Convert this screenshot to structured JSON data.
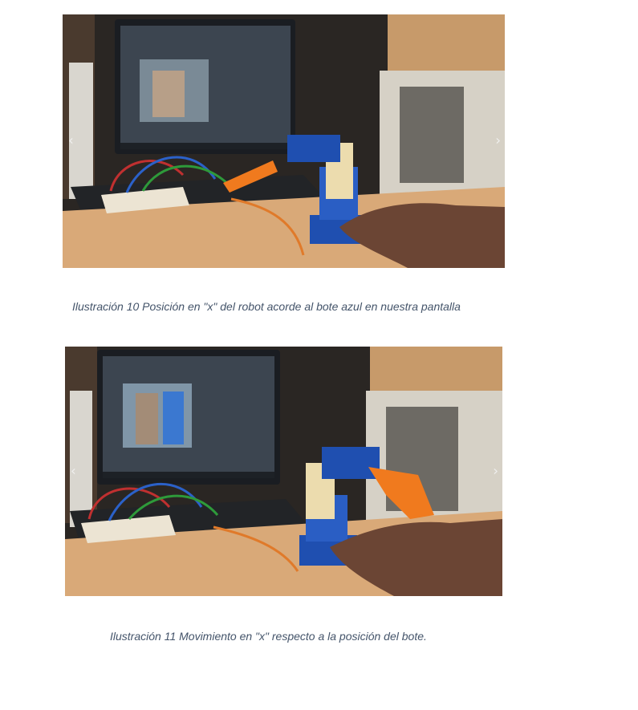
{
  "figures": [
    {
      "caption": "Ilustración 10 Posición en \"x\" del robot acorde al bote azul en nuestra pantalla",
      "nav": {
        "prev": "‹",
        "next": "›"
      }
    },
    {
      "caption": "Ilustración 11 Movimiento en \"x\" respecto a la posición del bote.",
      "nav": {
        "prev": "‹",
        "next": "›"
      }
    }
  ],
  "colors": {
    "caption_text": "#44546a",
    "robot_blue": "#1f4fb0",
    "gripper_orange": "#f07a1e",
    "desk": "#d9a978"
  }
}
